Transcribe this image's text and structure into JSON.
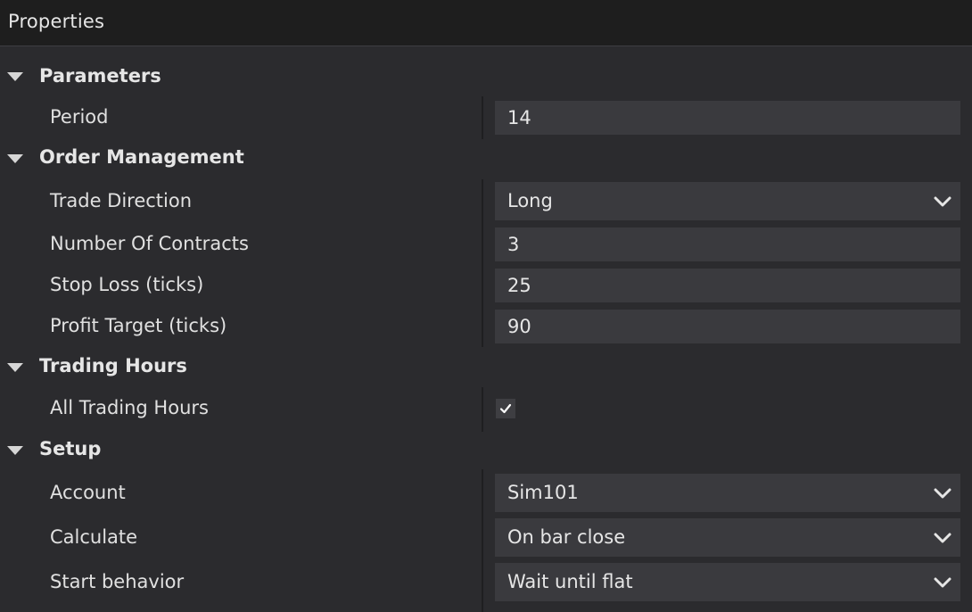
{
  "window": {
    "title": "Properties"
  },
  "categories": {
    "parameters": {
      "label": "Parameters"
    },
    "order_management": {
      "label": "Order Management"
    },
    "trading_hours": {
      "label": "Trading Hours"
    },
    "setup": {
      "label": "Setup"
    }
  },
  "properties": {
    "period": {
      "label": "Period",
      "value": "14"
    },
    "trade_direction": {
      "label": "Trade Direction",
      "value": "Long"
    },
    "number_of_contracts": {
      "label": "Number Of Contracts",
      "value": "3"
    },
    "stop_loss": {
      "label": "Stop Loss (ticks)",
      "value": "25"
    },
    "profit_target": {
      "label": "Profit Target (ticks)",
      "value": "90"
    },
    "all_trading_hours": {
      "label": "All Trading Hours",
      "checked": true
    },
    "account": {
      "label": "Account",
      "value": "Sim101"
    },
    "calculate": {
      "label": "Calculate",
      "value": "On bar close"
    },
    "start_behavior": {
      "label": "Start behavior",
      "value": "Wait until flat"
    }
  },
  "icons": {
    "expand": "triangle-down-icon",
    "dropdown": "chevron-down-icon",
    "check": "checkmark-icon"
  },
  "colors": {
    "background": "#2b2b2e",
    "titlebar": "#1e1e1e",
    "field": "#3a3a3e",
    "text": "#e6e6e6"
  }
}
